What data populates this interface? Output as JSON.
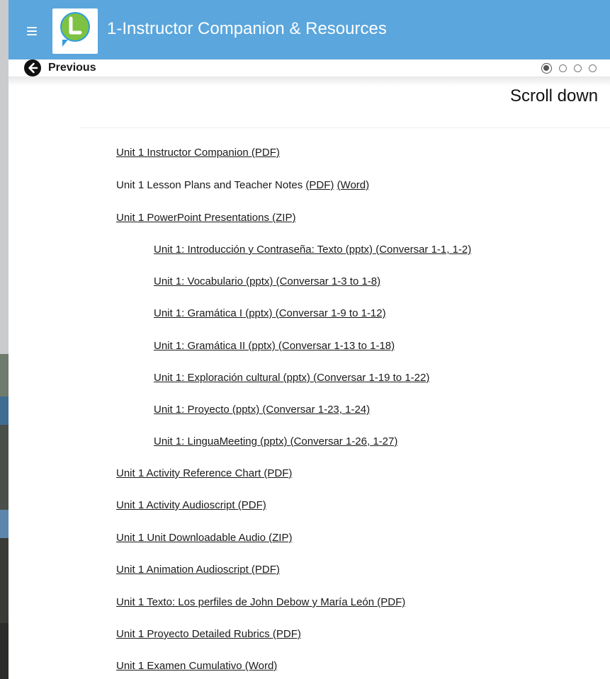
{
  "header": {
    "title": "1-Instructor Companion & Resources",
    "menu_icon": "hamburger-menu-icon",
    "logo_icon": "speech-bubble-L-logo",
    "colors": {
      "bar": "#5aa6dd",
      "logo_green": "#7dc242",
      "logo_blue": "#2f9de0"
    }
  },
  "navbar": {
    "previous_label": "Previous",
    "previous_icon": "arrow-left-circle-icon",
    "pager": {
      "active_index": 0,
      "visible_dots": 4
    }
  },
  "content": {
    "scroll_hint": "Scroll down",
    "items": [
      {
        "kind": "link",
        "text": "Unit 1 Instructor Companion (PDF)"
      },
      {
        "kind": "mixed",
        "prefix": "Unit 1 Lesson Plans and Teacher Notes ",
        "link1": "(PDF)",
        "sep": " ",
        "link2": "(Word)"
      },
      {
        "kind": "link",
        "text": "Unit 1 PowerPoint Presentations (ZIP)"
      },
      {
        "kind": "link",
        "text": "Unit 1: Introducción y Contraseña: Texto (pptx) (Conversar 1-1, 1-2)"
      },
      {
        "kind": "link",
        "text": "Unit 1: Vocabulario (pptx) (Conversar 1-3 to 1-8)"
      },
      {
        "kind": "link",
        "text": "Unit 1: Gramática I (pptx) (Conversar 1-9 to 1-12)"
      },
      {
        "kind": "link",
        "text": "Unit 1: Gramática II (pptx) (Conversar 1-13 to 1-18)"
      },
      {
        "kind": "link",
        "text": "Unit 1: Exploración cultural (pptx) (Conversar 1-19 to 1-22)"
      },
      {
        "kind": "link",
        "text": "Unit 1: Proyecto (pptx) (Conversar 1-23, 1-24)"
      },
      {
        "kind": "link",
        "text": "Unit 1: LinguaMeeting (pptx) (Conversar 1-26, 1-27)"
      },
      {
        "kind": "link",
        "text": "Unit 1 Activity Reference Chart (PDF)"
      },
      {
        "kind": "link",
        "text": "Unit 1 Activity Audioscript (PDF)"
      },
      {
        "kind": "link",
        "text": "Unit 1 Unit Downloadable Audio (ZIP)"
      },
      {
        "kind": "link",
        "text": "Unit 1 Animation Audioscript (PDF)"
      },
      {
        "kind": "link",
        "text": "Unit 1 Texto: Los perfiles de John Debow y María León (PDF)"
      },
      {
        "kind": "link",
        "text": "Unit 1 Proyecto Detailed Rubrics (PDF)"
      },
      {
        "kind": "link",
        "text": "Unit 1 Examen Cumulativo (Word)"
      }
    ]
  }
}
